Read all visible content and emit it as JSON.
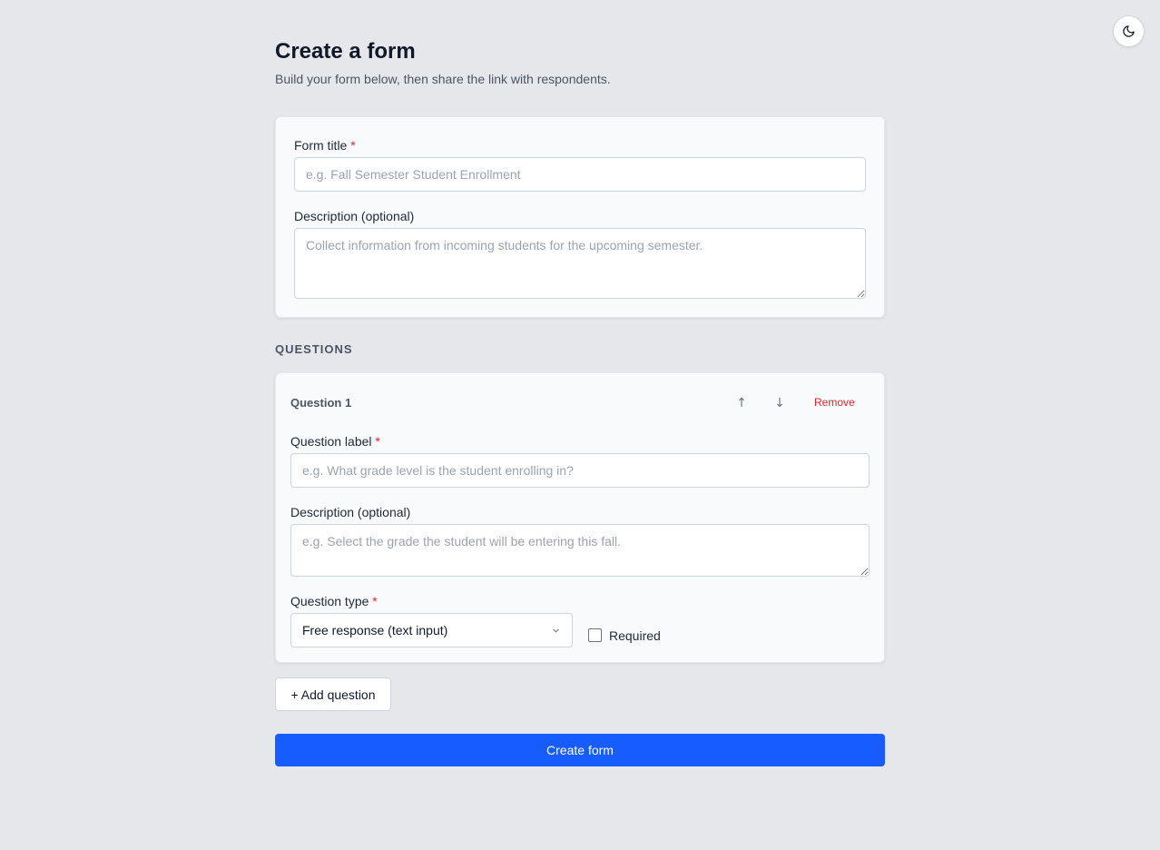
{
  "header": {
    "title": "Create a form",
    "subtitle": "Build your form below, then share the link with respondents."
  },
  "theme_toggle": {
    "icon": "moon-icon"
  },
  "form_details": {
    "title_label": "Form title",
    "title_required_mark": "*",
    "title_placeholder": "e.g. Fall Semester Student Enrollment",
    "title_value": "",
    "description_label": "Description (optional)",
    "description_placeholder": "Collect information from incoming students for the upcoming semester.",
    "description_value": ""
  },
  "questions_section": {
    "heading": "QUESTIONS",
    "questions": [
      {
        "heading": "Question 1",
        "move_up_icon": "↑",
        "move_down_icon": "↓",
        "remove_label": "Remove",
        "label_label": "Question label",
        "label_required_mark": "*",
        "label_placeholder": "e.g. What grade level is the student enrolling in?",
        "label_value": "",
        "description_label": "Description (optional)",
        "description_placeholder": "e.g. Select the grade the student will be entering this fall.",
        "description_value": "",
        "type_label": "Question type",
        "type_required_mark": "*",
        "type_selected": "Free response (text input)",
        "required_label": "Required",
        "required_checked": false
      }
    ]
  },
  "actions": {
    "add_question_label": "+ Add question",
    "create_form_label": "Create form"
  },
  "colors": {
    "background": "#e5e7eb",
    "primary": "#175cff",
    "danger": "#dc2626"
  }
}
